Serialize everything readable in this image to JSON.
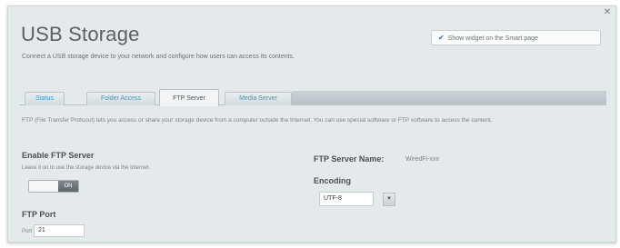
{
  "page": {
    "title": "USB Storage",
    "subtitle": "Connect a USB storage device to your network and configure how users can access its contents.",
    "widget_checkbox_label": "Show widget on the Smart page"
  },
  "tabs": [
    {
      "label": "Status"
    },
    {
      "label": "Folder Access"
    },
    {
      "label": "FTP Server"
    },
    {
      "label": "Media Server"
    }
  ],
  "ftp": {
    "description": "FTP (File Transfer Protocol) lets you access or share your storage device from a computer outside the Internet. You can use special software or FTP software to access the content.",
    "enable_label": "Enable FTP Server",
    "enable_help": "Leave it on to use the storage device via the Internet.",
    "toggle_state": "ON",
    "port_label": "FTP Port",
    "port_field_label": "Port",
    "port_value": "21",
    "server_name_label": "FTP Server Name:",
    "server_name_value": "WiredFi-xxx",
    "encoding_label": "Encoding",
    "encoding_value": "UTF-8"
  },
  "colors": {
    "panel_bg": "#e4e9ec",
    "tab_link": "#3e9ac2",
    "accent_check": "#2d6ec0"
  }
}
